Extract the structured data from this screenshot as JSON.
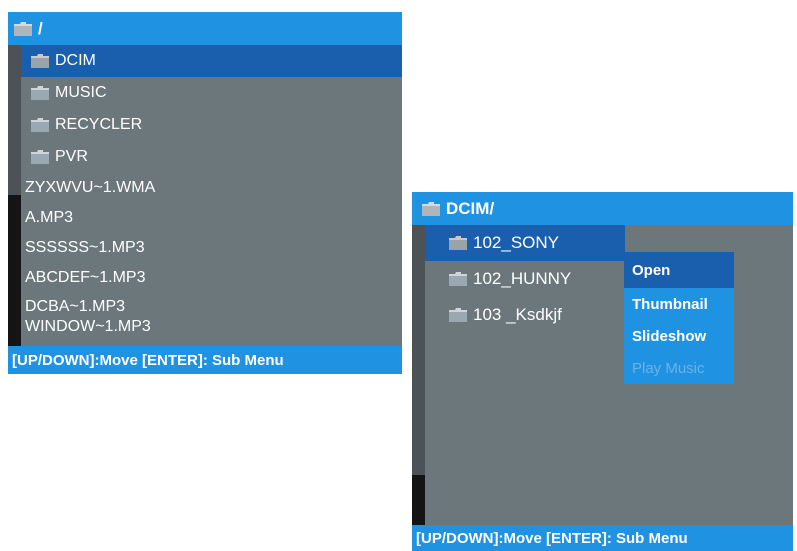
{
  "left": {
    "header_path": "/",
    "folders": [
      {
        "label": "DCIM",
        "selected": true
      },
      {
        "label": "MUSIC",
        "selected": false
      },
      {
        "label": "RECYCLER",
        "selected": false
      },
      {
        "label": "PVR",
        "selected": false
      }
    ],
    "files": [
      "ZYXWVU~1.WMA",
      "A.MP3",
      "SSSSSS~1.MP3",
      "ABCDEF~1.MP3",
      "DCBA~1.MP3",
      "WINDOW~1.MP3"
    ],
    "footer": "[UP/DOWN]:Move [ENTER]: Sub Menu"
  },
  "right": {
    "header_path": "DCIM/",
    "folders": [
      {
        "label": "102_SONY",
        "selected": true
      },
      {
        "label": "102_HUNNY",
        "selected": false
      },
      {
        "label": "103 _Ksdkjf",
        "selected": false
      }
    ],
    "context_menu": [
      {
        "label": "Open",
        "state": "active"
      },
      {
        "label": "Thumbnail",
        "state": "normal"
      },
      {
        "label": "Slideshow",
        "state": "normal"
      },
      {
        "label": "Play Music",
        "state": "disabled"
      }
    ],
    "footer": "[UP/DOWN]:Move [ENTER]: Sub Menu"
  },
  "colors": {
    "accent": "#1f93e2",
    "selection": "#1a5fae",
    "panel_bg": "#6b777b"
  }
}
